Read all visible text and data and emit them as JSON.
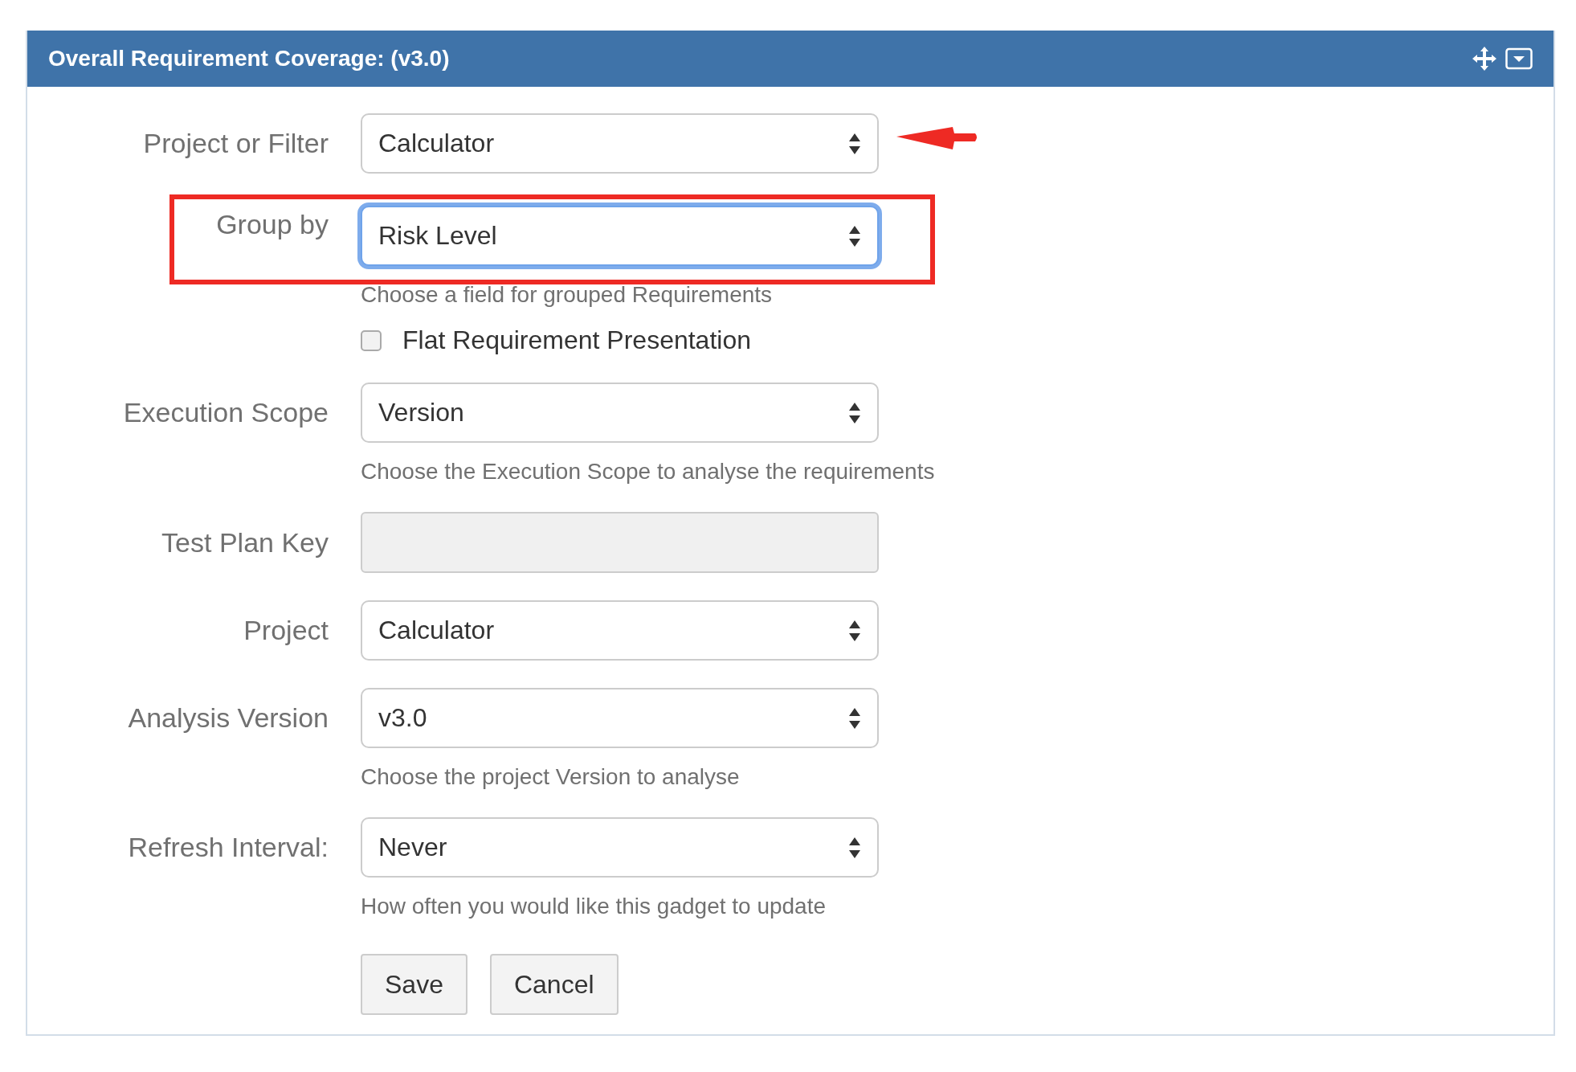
{
  "panel": {
    "title": "Overall Requirement Coverage: (v3.0)"
  },
  "rows": [
    {
      "kind": "select",
      "label": "Project or Filter",
      "value": "Calculator",
      "focused": false,
      "pointed_at": true
    },
    {
      "kind": "select",
      "label": "Group by",
      "value": "Risk Level",
      "focused": true,
      "framed": true
    },
    {
      "kind": "hint",
      "text": "Choose a field for grouped Requirements"
    },
    {
      "kind": "checkbox",
      "text": "Flat Requirement Presentation",
      "checked": false
    },
    {
      "kind": "select",
      "label": "Execution Scope",
      "value": "Version",
      "focused": false
    },
    {
      "kind": "hint",
      "text": "Choose the Execution Scope to analyse the requirements"
    },
    {
      "kind": "input",
      "label": "Test Plan Key",
      "disabled": true
    },
    {
      "kind": "select",
      "label": "Project",
      "value": "Calculator",
      "focused": false
    },
    {
      "kind": "select",
      "label": "Analysis Version",
      "value": "v3.0",
      "focused": false
    },
    {
      "kind": "hint",
      "text": "Choose the project Version to analyse"
    },
    {
      "kind": "select",
      "label": "Refresh Interval:",
      "value": "Never",
      "focused": false
    },
    {
      "kind": "hint",
      "text": "How often you would like this gadget to update"
    }
  ],
  "buttons": [
    {
      "label": "Save"
    },
    {
      "label": "Cancel"
    }
  ]
}
